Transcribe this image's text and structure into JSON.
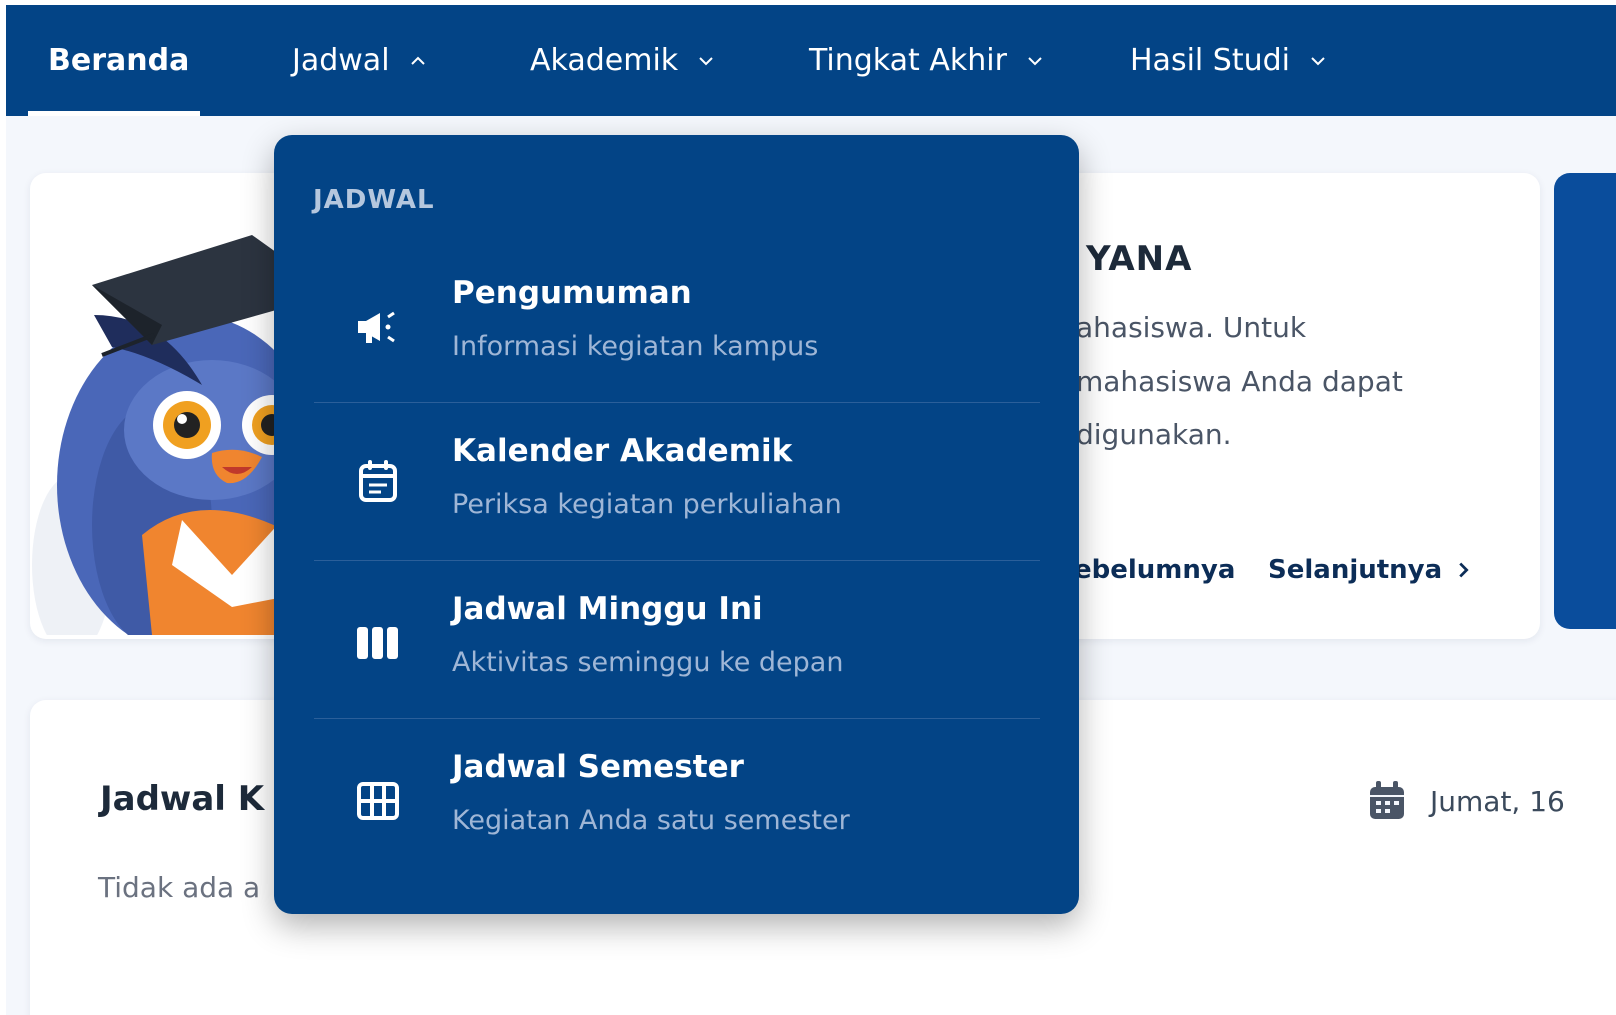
{
  "nav": {
    "items": [
      {
        "label": "Beranda"
      },
      {
        "label": "Jadwal"
      },
      {
        "label": "Akademik"
      },
      {
        "label": "Tingkat Akhir"
      },
      {
        "label": "Hasil Studi"
      }
    ]
  },
  "welcome": {
    "name_fragment": "YANA",
    "lines": [
      "ahasiswa. Untuk",
      "mahasiswa Anda dapat",
      "digunakan."
    ],
    "prev_label": "ebelumnya",
    "next_label": "Selanjutnya"
  },
  "schedule": {
    "title": "Jadwal K",
    "empty_text": "Tidak ada a",
    "date": "Jumat, 16"
  },
  "dropdown": {
    "heading": "JADWAL",
    "items": [
      {
        "title": "Pengumuman",
        "subtitle": "Informasi kegiatan kampus",
        "icon": "megaphone-icon"
      },
      {
        "title": "Kalender Akademik",
        "subtitle": "Periksa kegiatan perkuliahan",
        "icon": "calendar-icon"
      },
      {
        "title": "Jadwal Minggu Ini",
        "subtitle": "Aktivitas seminggu ke depan",
        "icon": "week-columns-icon"
      },
      {
        "title": "Jadwal Semester",
        "subtitle": "Kegiatan Anda satu semester",
        "icon": "grid-icon"
      }
    ]
  },
  "colors": {
    "nav_bg": "#034486",
    "dropdown_bg": "#034486",
    "page_bg": "#f4f7fc",
    "subtitle": "#9fb6d6",
    "link": "#0c2d57"
  }
}
